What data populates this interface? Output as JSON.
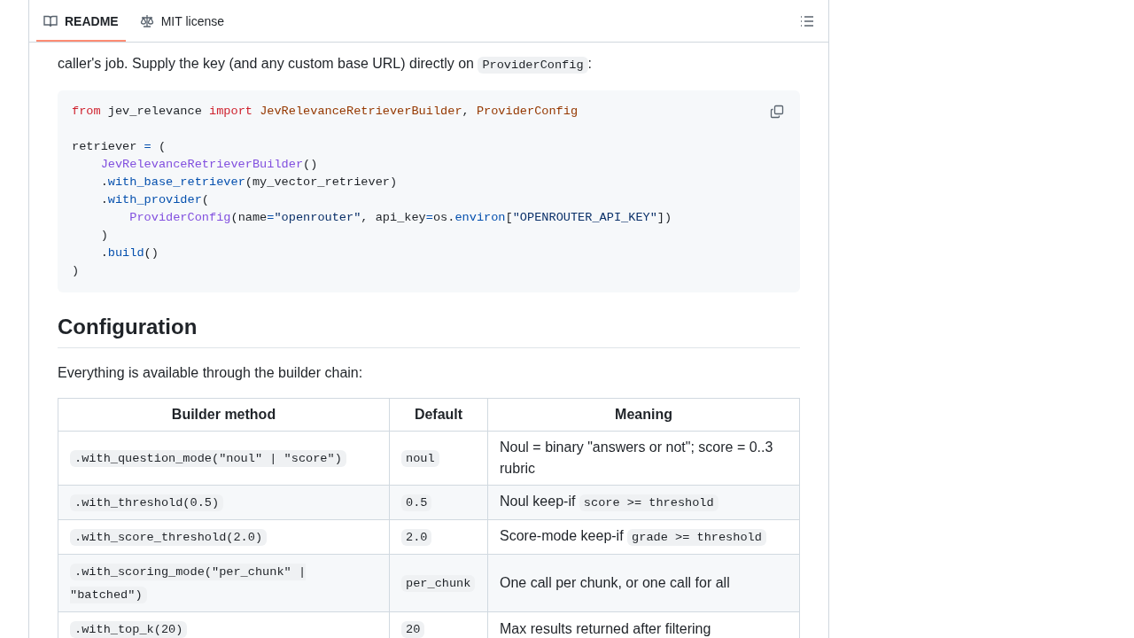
{
  "tabs": [
    {
      "label": "README",
      "selected": true
    },
    {
      "label": "MIT license",
      "selected": false
    }
  ],
  "intro": [
    {
      "kind": "text",
      "text": "caller's job. Supply the key (and any custom base URL) directly on "
    },
    {
      "kind": "code",
      "text": "ProviderConfig"
    },
    {
      "kind": "text",
      "text": ":"
    }
  ],
  "code_block": {
    "groups": [
      [
        [
          {
            "kind": "keyword",
            "text": "from"
          },
          {
            "kind": "plain",
            "text": " jev_relevance "
          },
          {
            "kind": "keyword",
            "text": "import"
          },
          {
            "kind": "name",
            "text": " JevRelevanceRetrieverBuilder"
          },
          {
            "kind": "plain",
            "text": ", "
          },
          {
            "kind": "name",
            "text": "ProviderConfig"
          }
        ]
      ],
      [
        [
          {
            "kind": "plain",
            "text": "retriever "
          },
          {
            "kind": "op",
            "text": "="
          },
          {
            "kind": "plain",
            "text": " ("
          }
        ],
        [
          {
            "kind": "class",
            "text": "    JevRelevanceRetrieverBuilder"
          },
          {
            "kind": "plain",
            "text": "()"
          }
        ],
        [
          {
            "kind": "plain",
            "text": "    ."
          },
          {
            "kind": "func",
            "text": "with_base_retriever"
          },
          {
            "kind": "plain",
            "text": "(my_vector_retriever)"
          }
        ],
        [
          {
            "kind": "plain",
            "text": "    ."
          },
          {
            "kind": "func",
            "text": "with_provider"
          },
          {
            "kind": "plain",
            "text": "("
          }
        ],
        [
          {
            "kind": "class",
            "text": "        ProviderConfig"
          },
          {
            "kind": "plain",
            "text": "(name"
          },
          {
            "kind": "op",
            "text": "="
          },
          {
            "kind": "string",
            "text": "\"openrouter\""
          },
          {
            "kind": "plain",
            "text": ", api_key"
          },
          {
            "kind": "op",
            "text": "="
          },
          {
            "kind": "plain",
            "text": "os."
          },
          {
            "kind": "func",
            "text": "environ"
          },
          {
            "kind": "plain",
            "text": "["
          },
          {
            "kind": "string",
            "text": "\"OPENROUTER_API_KEY\""
          },
          {
            "kind": "plain",
            "text": "])"
          }
        ],
        [
          {
            "kind": "plain",
            "text": "    )"
          }
        ],
        [
          {
            "kind": "plain",
            "text": "    ."
          },
          {
            "kind": "func",
            "text": "build"
          },
          {
            "kind": "plain",
            "text": "()"
          }
        ],
        [
          {
            "kind": "plain",
            "text": ")"
          }
        ]
      ]
    ]
  },
  "heading": "Configuration",
  "lead": "Everything is available through the builder chain:",
  "table": {
    "columns": [
      "Builder method",
      "Default",
      "Meaning"
    ],
    "rows": [
      {
        "method": ".with_question_mode(\"noul\" | \"score\")",
        "default": "noul",
        "meaning": [
          {
            "kind": "text",
            "text": "Noul = binary \"answers or not\"; score = 0..3 rubric"
          }
        ]
      },
      {
        "method": ".with_threshold(0.5)",
        "default": "0.5",
        "meaning": [
          {
            "kind": "text",
            "text": "Noul keep-if "
          },
          {
            "kind": "code",
            "text": "score >= threshold"
          }
        ]
      },
      {
        "method": ".with_score_threshold(2.0)",
        "default": "2.0",
        "meaning": [
          {
            "kind": "text",
            "text": "Score-mode keep-if "
          },
          {
            "kind": "code",
            "text": "grade >= threshold"
          }
        ]
      },
      {
        "method": ".with_scoring_mode(\"per_chunk\" | \"batched\")",
        "default": "per_chunk",
        "meaning": [
          {
            "kind": "text",
            "text": "One call per chunk, or one call for all"
          }
        ]
      },
      {
        "method": ".with_top_k(20)",
        "default": "20",
        "meaning": [
          {
            "kind": "text",
            "text": "Max results returned after filtering"
          }
        ]
      }
    ]
  }
}
